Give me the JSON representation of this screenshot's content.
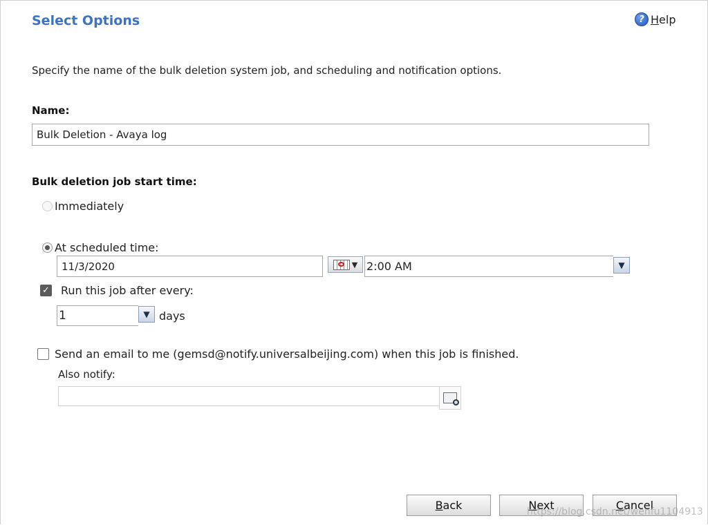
{
  "header": {
    "title": "Select Options",
    "help_label": "Help",
    "help_icon_glyph": "?"
  },
  "description": "Specify the name of the bulk deletion system job, and scheduling and notification options.",
  "name_section": {
    "label": "Name:",
    "value": "Bulk Deletion - Avaya log"
  },
  "start_time": {
    "label": "Bulk deletion job start time:",
    "immediately_label": "Immediately",
    "scheduled_label": "At scheduled time:",
    "date_value": "11/3/2020",
    "time_value": "2:00 AM"
  },
  "recurrence": {
    "label": "Run this job after every:",
    "interval_value": "1",
    "unit_label": "days",
    "checked": true
  },
  "notification": {
    "email_label": "Send an email to me (gemsd@notify.universalbeijing.com) when this job is finished.",
    "also_notify_label": "Also notify:",
    "also_notify_value": ""
  },
  "footer": {
    "back_label": "Back",
    "next_label": "Next",
    "cancel_label": "Cancel"
  },
  "watermark": "https://blog.csdn.net/wenfu1104913",
  "colors": {
    "title": "#3b73c5",
    "check_fill": "#5b5b5b"
  }
}
